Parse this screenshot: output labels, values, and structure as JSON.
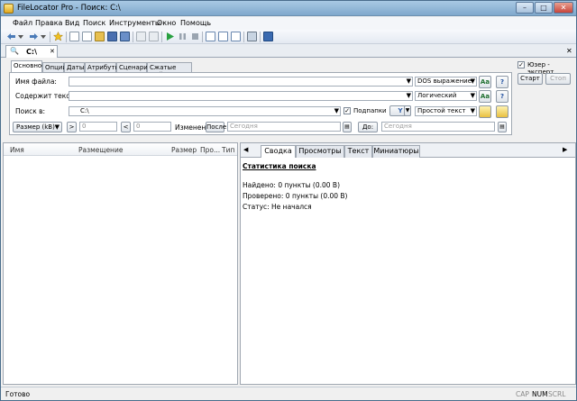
{
  "window": {
    "title": "FileLocator Pro - Поиск: C:\\"
  },
  "window_buttons": {
    "minimize": "–",
    "maximize": "□",
    "close": "✕"
  },
  "menu": [
    "Файл",
    "Правка",
    "Вид",
    "Поиск",
    "Инструменты",
    "Окно",
    "Помощь"
  ],
  "doc_tab": {
    "label": "C:\\",
    "close": "✕"
  },
  "search_tabs": [
    "Основное",
    "Опции",
    "Даты",
    "Атрибуты",
    "Сценарии",
    "Сжатые файлы"
  ],
  "form": {
    "filename_label": "Имя файла:",
    "filename_value": "",
    "filename_mode": "DOS выражение",
    "contains_label": "Содержит текст:",
    "contains_value": "",
    "contains_mode": "Логический",
    "lookin_label": "Поиск в:",
    "lookin_value": "C:\\",
    "subfolders_label": "Подпапки",
    "subfolders_checked": true,
    "text_mode": "Простой текст",
    "size_unit": "Размер (kB)",
    "size_gt": ">",
    "size_gt_value": "0",
    "size_lt": "<",
    "size_lt_value": "0",
    "modified_label": "Изменен:",
    "after_label": "После:",
    "after_placeholder": "Сегодня",
    "before_label": "До:",
    "before_placeholder": "Сегодня",
    "case_label": "Aa",
    "help_label": "?",
    "filter_icon_text": "Y"
  },
  "expert": {
    "label": "Юзер - эксперт",
    "checked": true,
    "start": "Старт",
    "stop": "Стоп"
  },
  "results": {
    "columns": [
      "Имя",
      "Размещение",
      "Размер",
      "Про...",
      "Тип"
    ]
  },
  "report_tabs": {
    "left_arrow": "◀",
    "right_arrow": "▶",
    "tabs": [
      "Сводка",
      "Просмотры",
      "Текст",
      "Миниатюры"
    ]
  },
  "report": {
    "heading": "Статистика поиска",
    "found": "Найдено: 0 пункты (0.00 B)",
    "checked": "Проверено: 0 пункты (0.00 B)",
    "status": "Статус: Не начался"
  },
  "status_bar": {
    "text": "Готово",
    "cap": "CAP",
    "num": "NUM",
    "scrl": "SCRL"
  }
}
